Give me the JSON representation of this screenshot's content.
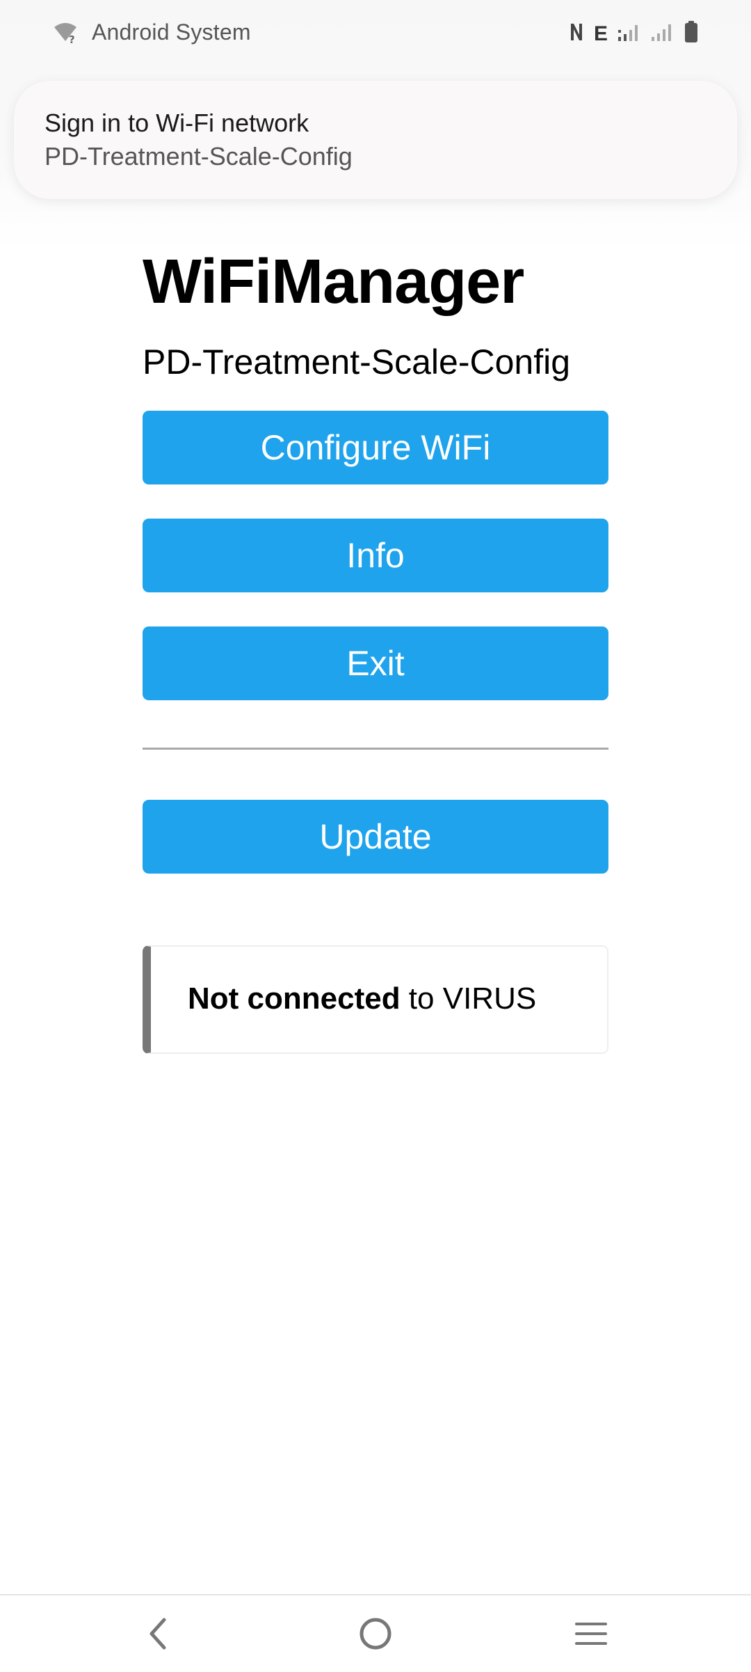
{
  "status_bar": {
    "app_name": "Android System",
    "network_type": "E",
    "icons": [
      "wifi-question-icon",
      "nfc-icon",
      "signal-sim1-icon",
      "signal-sim2-icon",
      "battery-icon"
    ]
  },
  "notification": {
    "title": "Sign in to Wi-Fi network",
    "network": "PD-Treatment-Scale-Config"
  },
  "page": {
    "title": "WiFiManager",
    "ssid": "PD-Treatment-Scale-Config",
    "buttons": {
      "configure": "Configure WiFi",
      "info": "Info",
      "exit": "Exit",
      "update": "Update"
    },
    "status": {
      "state": "Not connected",
      "suffix": " to VIRUS"
    }
  },
  "nav_bar": {
    "icons": [
      "back-icon",
      "home-icon",
      "recents-icon"
    ]
  },
  "colors": {
    "button": "#1fa3ec",
    "message_border": "#777777"
  }
}
